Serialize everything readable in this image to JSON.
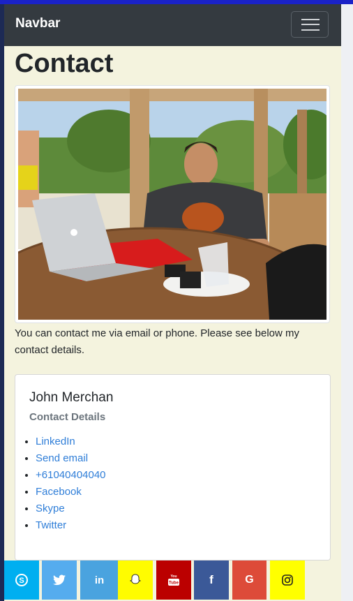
{
  "navbar": {
    "brand": "Navbar",
    "toggle_icon": "hamburger-icon"
  },
  "page": {
    "title": "Contact",
    "photo_alt": ""
  },
  "intro": {
    "text": "You can contact me via email or phone. Please see below my contact details."
  },
  "card": {
    "name": "John Merchan",
    "subtitle": "Contact Details",
    "links": [
      {
        "label": "LinkedIn"
      },
      {
        "label": "Send email"
      },
      {
        "label": "+61040404040"
      },
      {
        "label": "Facebook"
      },
      {
        "label": "Skype"
      },
      {
        "label": "Twitter"
      }
    ]
  },
  "social": [
    {
      "name": "skype",
      "icon": "skype-icon",
      "color": "#00aff0",
      "glyph": "S"
    },
    {
      "name": "twitter",
      "icon": "twitter-icon",
      "color": "#55acee",
      "glyph": "t"
    },
    {
      "name": "linkedin",
      "icon": "linkedin-icon",
      "color": "#4aa3df",
      "glyph": "in"
    },
    {
      "name": "snapchat",
      "icon": "snapchat-icon",
      "color": "#fffc00",
      "glyph": "👻"
    },
    {
      "name": "youtube",
      "icon": "youtube-icon",
      "color": "#bb0000",
      "glyph": "▶"
    },
    {
      "name": "facebook",
      "icon": "facebook-icon",
      "color": "#3b5998",
      "glyph": "f"
    },
    {
      "name": "google",
      "icon": "google-icon",
      "color": "#dd4b39",
      "glyph": "G"
    },
    {
      "name": "instagram",
      "icon": "instagram-icon",
      "color": "#ffff00",
      "glyph": "◎"
    }
  ]
}
